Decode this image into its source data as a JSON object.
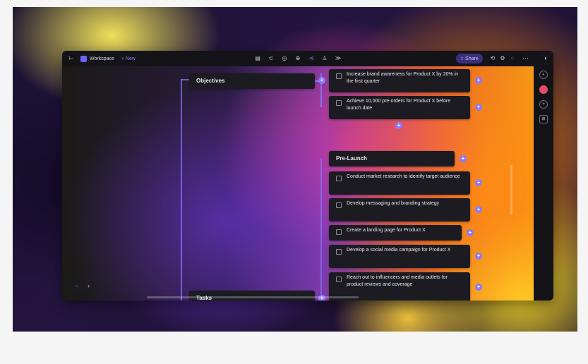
{
  "topbar": {
    "workspace_label": "Workspace",
    "new_label": "+ New",
    "share_label": "Share",
    "more_label": "···"
  },
  "mindmap": {
    "objectives_title": "Objectives",
    "objectives": [
      "Increase brand awareness for Product X by 20% in the first quarter",
      "Achieve 10,000 pre-orders for Product X before launch date"
    ],
    "prelaunch_title": "Pre-Launch",
    "prelaunch": [
      "Conduct market research to identify target audience",
      "Develop messaging and branding strategy",
      "Create a landing page for Product X",
      "Develop a social media campaign for Product X",
      "Reach out to influencers and media outlets for product reviews and coverage"
    ],
    "tasks_title": "Tasks"
  },
  "plus_symbol": "+",
  "colors": {
    "accent": "#8b79ff",
    "node_bg": "#1c1b22",
    "topbar_bg": "#141318"
  },
  "icons": [
    "sidebar-toggle-icon",
    "workspace-logo-icon",
    "layout-icon",
    "search-icon",
    "clock-icon",
    "settings-icon",
    "more-icon",
    "panel-icon"
  ]
}
